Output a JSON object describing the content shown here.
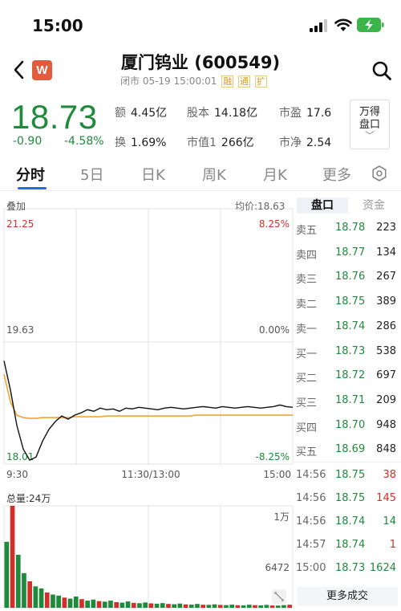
{
  "status_bar": {
    "time": "15:00"
  },
  "nav": {
    "app_badge": "W",
    "title": "厦门钨业 (600549)",
    "subtitle": "闭市 05-19 15:00:01",
    "tags": [
      "融",
      "通",
      "扩"
    ]
  },
  "quote": {
    "price": "18.73",
    "change": "-0.90",
    "change_pct": "-4.58%",
    "stats": [
      {
        "k": "额",
        "v": "4.45亿"
      },
      {
        "k": "股本",
        "v": "14.18亿"
      },
      {
        "k": "市盈",
        "v": "17.6"
      },
      {
        "k": "换",
        "v": "1.69%"
      },
      {
        "k": "市值1",
        "v": "266亿"
      },
      {
        "k": "市净",
        "v": "2.54"
      }
    ],
    "wind_line1": "万得",
    "wind_line2": "盘口",
    "wind_caret": "﹀"
  },
  "tabs": [
    "分时",
    "5日",
    "日K",
    "周K",
    "月K",
    "更多"
  ],
  "chart": {
    "overlay_label": "叠加",
    "avg_price_label": "均价:18.63",
    "y_high": "21.25",
    "y_mid": "19.63",
    "y_low": "18.01",
    "pct_high": "8.25%",
    "pct_mid": "0.00%",
    "pct_low": "-8.25%",
    "time_start": "9:30",
    "time_mid": "11:30/13:00",
    "time_end": "15:00",
    "volume_label": "总量:24万",
    "vol_high": "1万",
    "vol_mid": "6472"
  },
  "chart_data": {
    "type": "line",
    "title": "",
    "ylim": [
      18.01,
      21.25
    ],
    "series": [
      {
        "values": [
          19.32,
          18.95,
          18.5,
          18.2,
          18.06,
          18.1,
          18.3,
          18.45,
          18.55,
          18.62,
          18.58,
          18.63,
          18.66,
          18.7,
          18.68,
          18.72,
          18.7,
          18.71,
          18.68,
          18.72,
          18.71,
          18.73,
          18.72,
          18.71,
          18.7,
          18.72,
          18.73,
          18.72,
          18.71,
          18.72,
          18.73,
          18.74,
          18.73,
          18.72,
          18.74,
          18.73,
          18.72,
          18.73,
          18.74,
          18.73,
          18.72,
          18.73,
          18.74,
          18.76,
          18.74,
          18.73
        ]
      },
      {
        "values": [
          19.15,
          18.8,
          18.63,
          18.6,
          18.59,
          18.59,
          18.6,
          18.6,
          18.6,
          18.6,
          18.6,
          18.61,
          18.61,
          18.61,
          18.61,
          18.61,
          18.62,
          18.62,
          18.62,
          18.62,
          18.62,
          18.62,
          18.62,
          18.62,
          18.62,
          18.62,
          18.62,
          18.62,
          18.62,
          18.62,
          18.63,
          18.63,
          18.63,
          18.63,
          18.63,
          18.63,
          18.63,
          18.63,
          18.63,
          18.63,
          18.63,
          18.63,
          18.63,
          18.63,
          18.63,
          18.63
        ]
      }
    ],
    "volume": [
      6472,
      10000,
      5200,
      3400,
      2600,
      2100,
      1900,
      1500,
      1300,
      1200,
      1000,
      900,
      1100,
      850,
      700,
      800,
      650,
      600,
      700,
      550,
      500,
      620,
      480,
      450,
      520,
      430,
      400,
      460,
      380,
      350,
      420,
      330,
      310,
      380,
      300,
      290,
      340,
      280,
      260,
      310,
      250,
      240,
      300,
      260,
      240,
      280,
      230,
      220,
      260,
      300
    ],
    "yvol_max": 10000
  },
  "order_book": {
    "tabs": [
      "盘口",
      "资金"
    ],
    "rows": [
      {
        "label": "卖五",
        "price": "18.78",
        "vol": "223",
        "color": ""
      },
      {
        "label": "卖四",
        "price": "18.77",
        "vol": "134",
        "color": ""
      },
      {
        "label": "卖三",
        "price": "18.76",
        "vol": "267",
        "color": ""
      },
      {
        "label": "卖二",
        "price": "18.75",
        "vol": "389",
        "color": ""
      },
      {
        "label": "卖一",
        "price": "18.74",
        "vol": "286",
        "color": ""
      },
      {
        "label": "买一",
        "price": "18.73",
        "vol": "538",
        "color": ""
      },
      {
        "label": "买二",
        "price": "18.72",
        "vol": "697",
        "color": ""
      },
      {
        "label": "买三",
        "price": "18.71",
        "vol": "209",
        "color": ""
      },
      {
        "label": "买四",
        "price": "18.70",
        "vol": "948",
        "color": ""
      },
      {
        "label": "买五",
        "price": "18.69",
        "vol": "848",
        "color": ""
      }
    ],
    "trades": [
      {
        "time": "14:56",
        "price": "18.75",
        "vol": "38",
        "color": "red"
      },
      {
        "time": "14:56",
        "price": "18.75",
        "vol": "145",
        "color": "red"
      },
      {
        "time": "14:56",
        "price": "18.74",
        "vol": "14",
        "color": "green"
      },
      {
        "time": "14:57",
        "price": "18.74",
        "vol": "1",
        "color": "red"
      },
      {
        "time": "15:00",
        "price": "18.73",
        "vol": "1624",
        "color": "green"
      }
    ],
    "more_label": "更多成交"
  },
  "colors": {
    "up": "#d0302b",
    "down": "#1f8a3c",
    "avg_line": "#f0a431",
    "price_line": "#111111"
  }
}
